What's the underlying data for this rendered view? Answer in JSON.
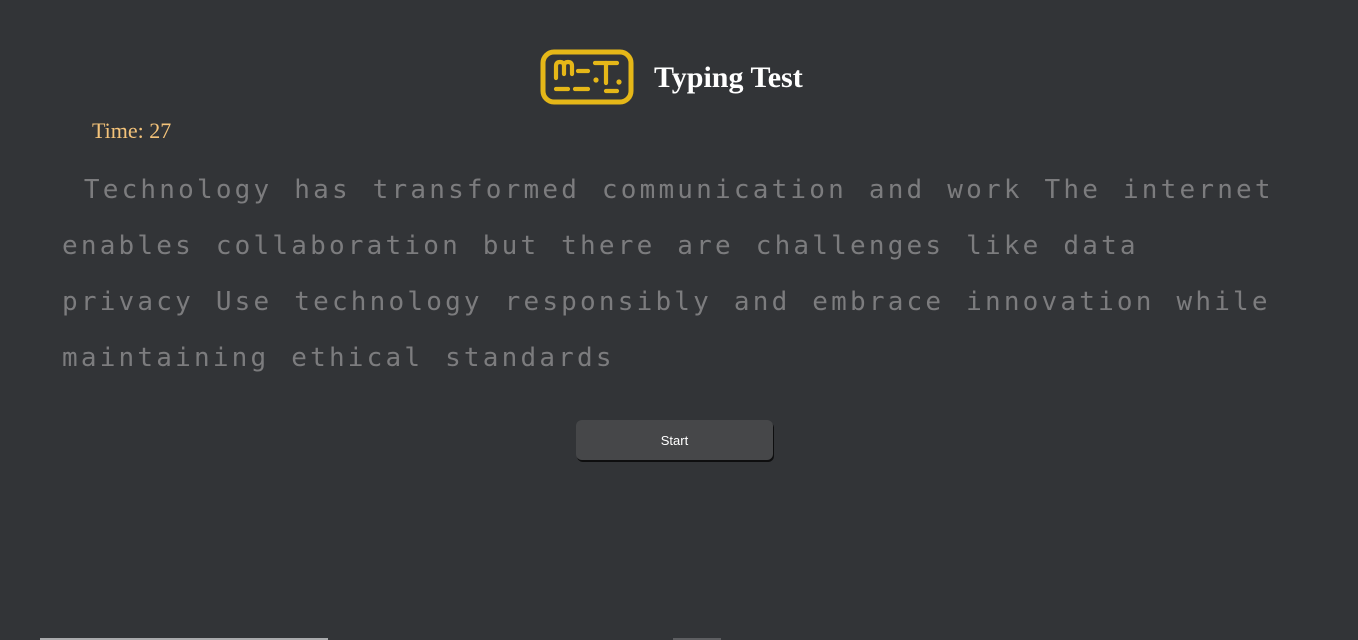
{
  "header": {
    "title": "Typing Test",
    "logo_icon": "mt-logo-icon",
    "logo_color": "#e5b718"
  },
  "timer": {
    "label": "Time: 27"
  },
  "passage": {
    "text": " Technology has transformed communication and work The internet enables collaboration but there are challenges like data privacy Use technology responsibly and embrace innovation while maintaining ethical standards"
  },
  "controls": {
    "start_label": "Start"
  },
  "colors": {
    "background": "#323437",
    "title": "#ffffff",
    "timer": "#f4c37a",
    "passage_text": "#7c7c7e",
    "button_bg": "#464749"
  }
}
